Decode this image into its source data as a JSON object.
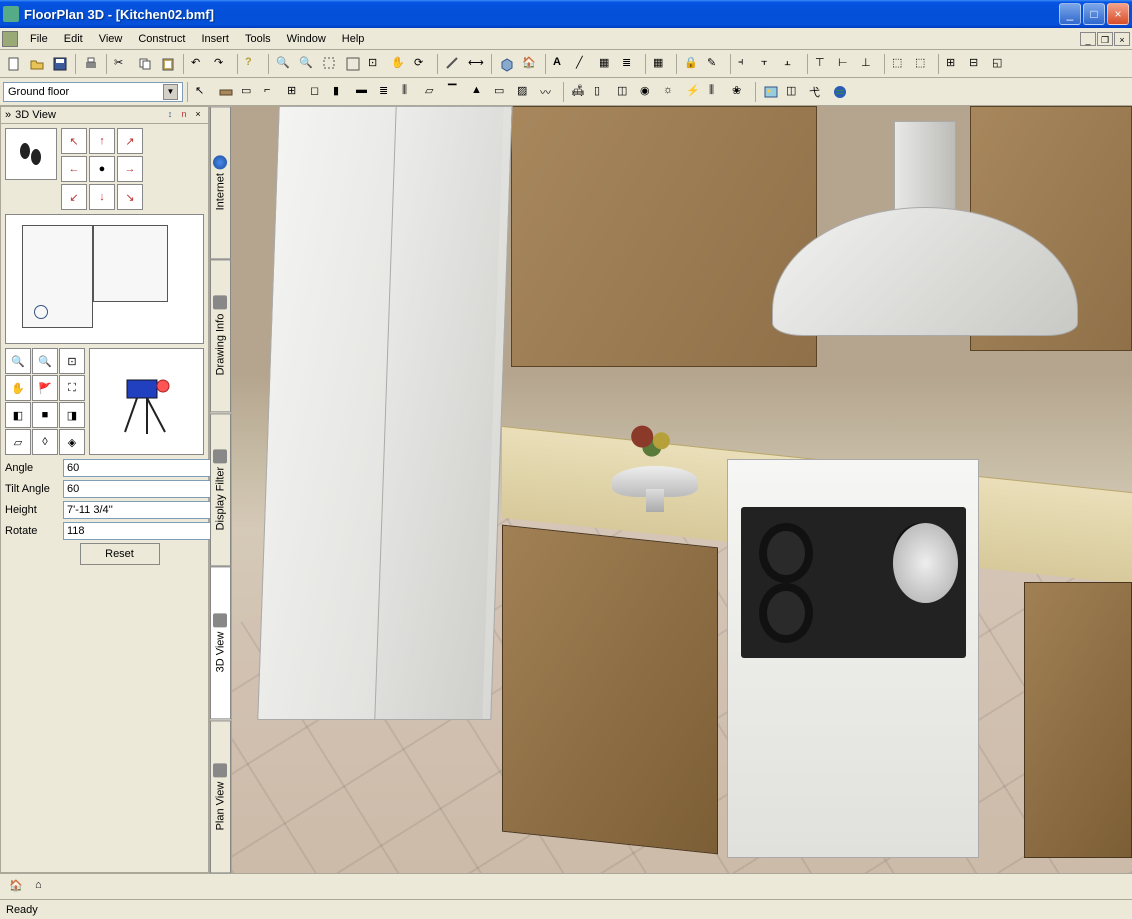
{
  "window": {
    "title": "FloorPlan 3D - [Kitchen02.bmf]"
  },
  "menu": [
    "File",
    "Edit",
    "View",
    "Construct",
    "Insert",
    "Tools",
    "Window",
    "Help"
  ],
  "floor_combo": "Ground floor",
  "panel": {
    "title": "3D View",
    "angle_label": "Angle",
    "angle_value": "60",
    "tilt_label": "Tilt Angle",
    "tilt_value": "60",
    "height_label": "Height",
    "height_value": "7'-11 3/4''",
    "rotate_label": "Rotate",
    "rotate_value": "118",
    "reset": "Reset"
  },
  "sidetabs": [
    "Internet",
    "Drawing Info",
    "Display Filter",
    "3D View",
    "Plan View"
  ],
  "status": "Ready",
  "pin_icons": [
    "↕",
    "n",
    "×"
  ]
}
